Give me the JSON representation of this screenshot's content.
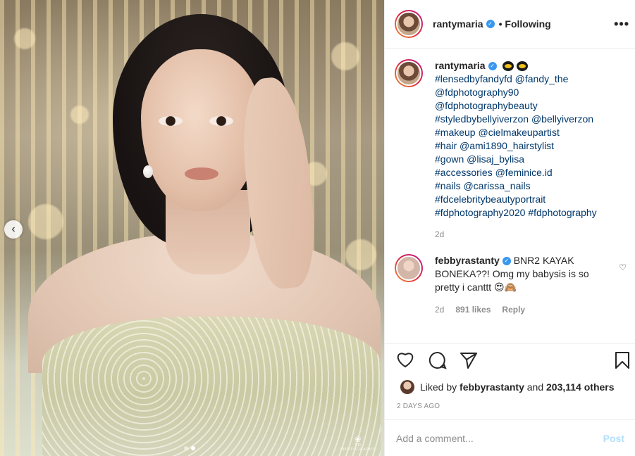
{
  "post": {
    "username": "rantymaria",
    "follow_status": "Following",
    "more_icon": "•••",
    "caption_lines": [
      "#lensedbyfandyfd @fandy_the",
      "@fdphotography90",
      "@fdphotographybeauty",
      "#styledbybellyiverzon @bellyiverzon",
      "#makeup @cielmakeupartist",
      "#hair @ami1890_hairstylist",
      "#gown @lisaj_bylisa",
      "#accessories @feminice.id",
      "#nails @carissa_nails",
      "#fdcelebritybeautyportrait",
      "#fdphotography2020 #fdphotography"
    ],
    "caption_time": "2d"
  },
  "comment": {
    "username": "febbyrastanty",
    "text": "BNR2 KAYAK BONEKA??! Omg my babysis is so pretty i canttt",
    "emojis": "😍🙈",
    "time": "2d",
    "likes": "891 likes",
    "reply": "Reply"
  },
  "likes": {
    "prefix": "Liked by",
    "user": "febbyrastanty",
    "and": "and",
    "others": "203,114 others"
  },
  "date": "2 DAYS AGO",
  "add_comment": {
    "placeholder": "Add a comment...",
    "post_label": "Post"
  },
  "media": {
    "watermark": "FD PHOTOGRAPHY",
    "carousel_dots": 2,
    "active_dot": 1
  },
  "icons": {
    "like": "heart-icon",
    "comment": "comment-icon",
    "share": "send-icon",
    "save": "bookmark-icon",
    "prev": "chevron-left-icon"
  },
  "colors": {
    "link": "#00376b",
    "verified": "#3897f0",
    "post_disabled": "#b2dffc",
    "muted": "#8e8e8e"
  }
}
